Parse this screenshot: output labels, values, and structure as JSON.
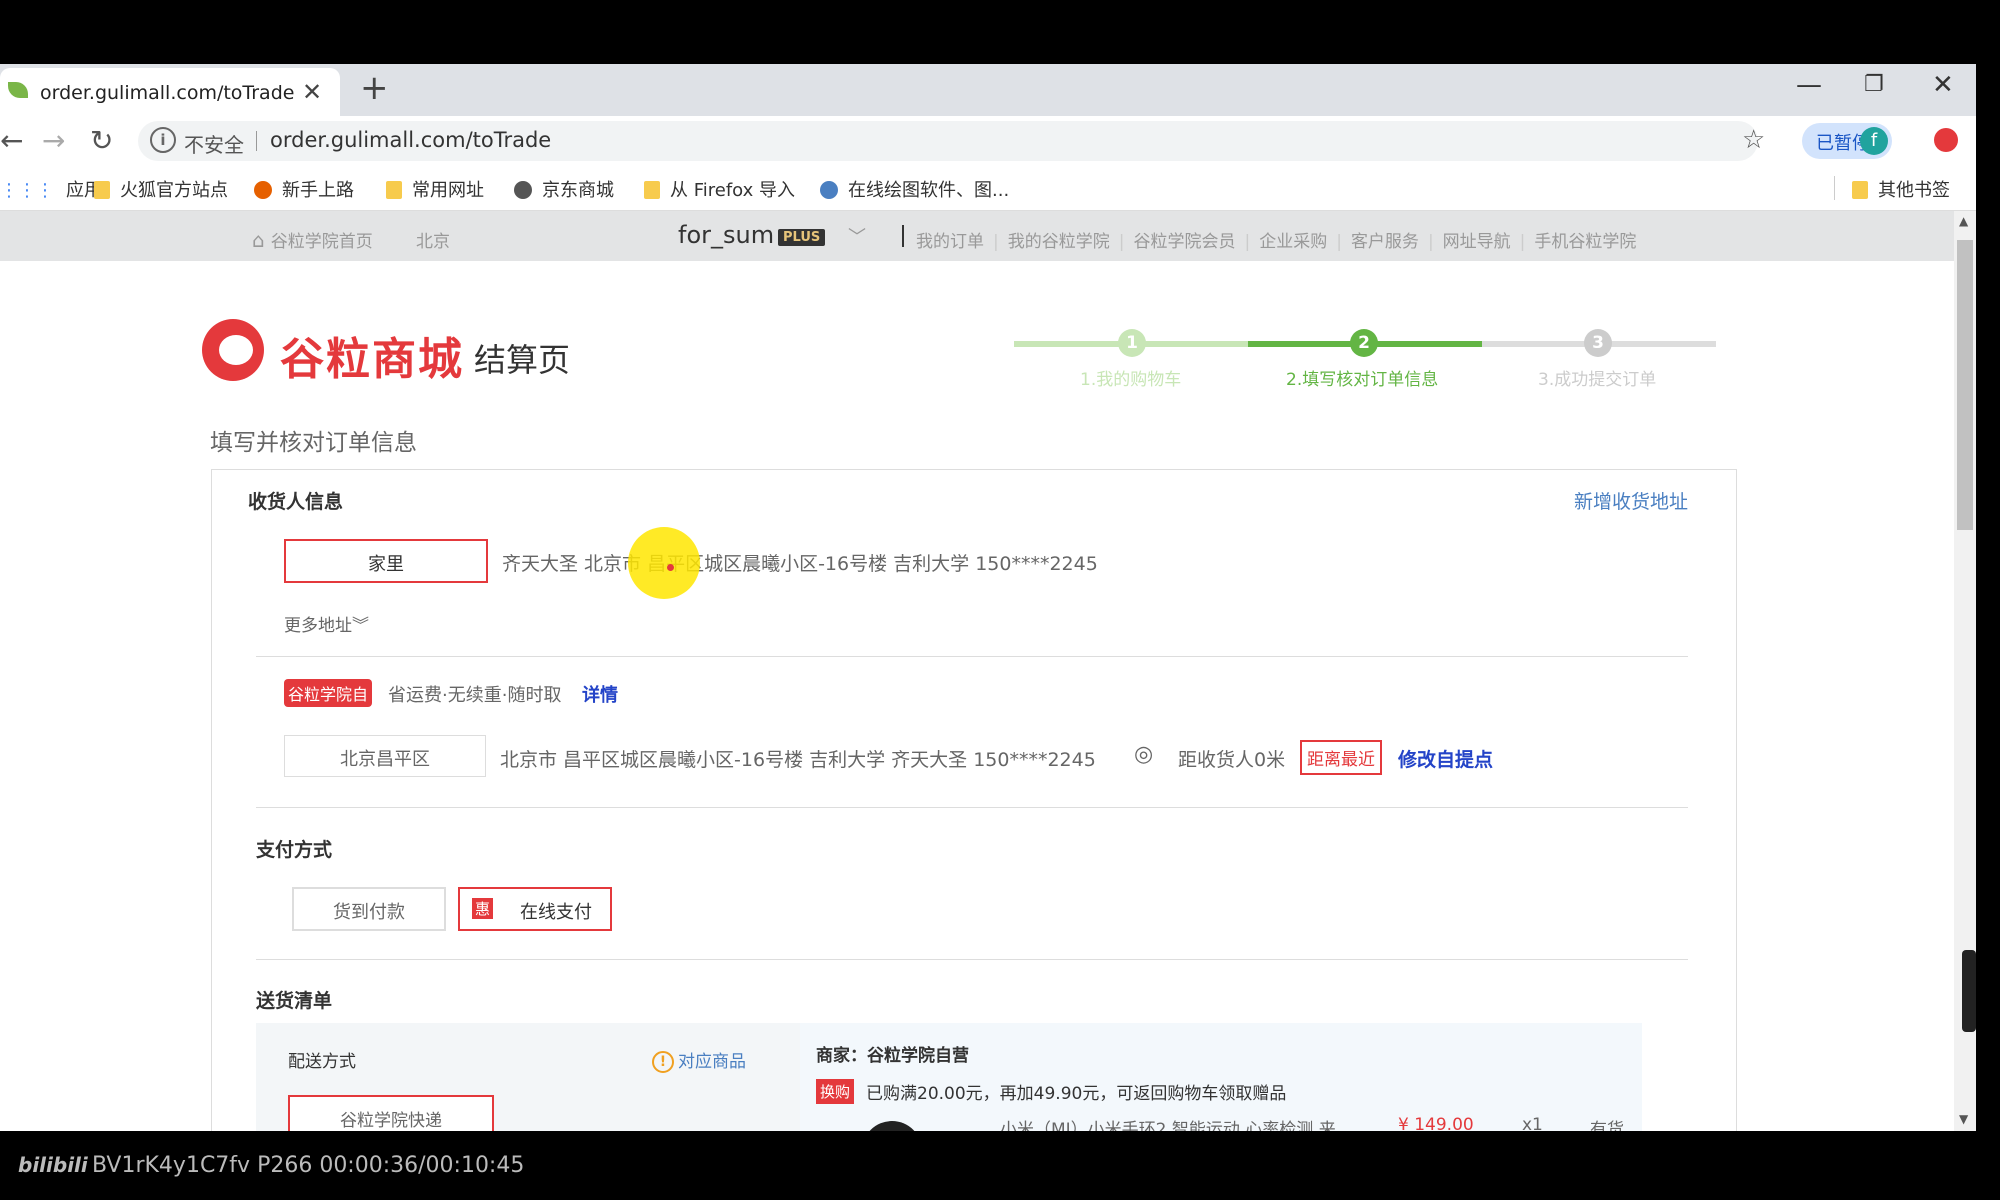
{
  "browser": {
    "tab_title": "order.gulimall.com/toTrade",
    "insecure_label": "不安全",
    "url": "order.gulimall.com/toTrade",
    "paused_label": "已暂停",
    "avatar_letter": "f",
    "bookmarks": [
      "应用",
      "火狐官方站点",
      "新手上路",
      "常用网址",
      "京东商城",
      "从 Firefox 导入",
      "在线绘图软件、图..."
    ],
    "other_bookmarks": "其他书签"
  },
  "topnav": {
    "home": "谷粒学院首页",
    "city": "北京",
    "username": "for_sum",
    "plus_badge": "PLUS",
    "links": [
      "我的订单",
      "我的谷粒学院",
      "谷粒学院会员",
      "企业采购",
      "客户服务",
      "网址导航",
      "手机谷粒学院"
    ]
  },
  "header": {
    "logo_text": "谷粒商城",
    "page_name": "结算页"
  },
  "steps": [
    {
      "num": "1",
      "label": "1.我的购物车"
    },
    {
      "num": "2",
      "label": "2.填写核对订单信息"
    },
    {
      "num": "3",
      "label": "3.成功提交订单"
    }
  ],
  "section_title": "填写并核对订单信息",
  "receiver": {
    "heading": "收货人信息",
    "add_address": "新增收货地址",
    "selected_tag": "家里",
    "address_line": "齐天大圣 北京市 昌平区城区晨曦小区-16号楼 吉利大学 150****2245",
    "more_addresses": "更多地址︾"
  },
  "pickup": {
    "tag": "谷粒学院自",
    "desc": "省运费·无续重·随时取",
    "details": "详情",
    "location": "北京昌平区",
    "address": "北京市 昌平区城区晨曦小区-16号楼 吉利大学 齐天大圣 150****2245",
    "distance": "距收货人0米",
    "nearest": "距离最近",
    "modify": "修改自提点"
  },
  "payment": {
    "heading": "支付方式",
    "cod": "货到付款",
    "hui": "惠",
    "online": "在线支付"
  },
  "delivery": {
    "heading": "送货清单",
    "method_label": "配送方式",
    "corresponding": "对应商品",
    "express": "谷粒学院快递",
    "merchant": "商家：谷粒学院自营",
    "swap_tag": "换购",
    "promo": "已购满20.00元，再加49.90元，可返回购物车领取赠品",
    "item_name": "小米（MI）小米手环2 智能运动 心率检测 来",
    "item_price": "¥ 149.00",
    "item_qty": "x1",
    "item_stock": "有货"
  },
  "video_overlay": {
    "logo": "bilibili",
    "info": "BV1rK4y1C7fv P266 00:00:36/00:10:45"
  }
}
